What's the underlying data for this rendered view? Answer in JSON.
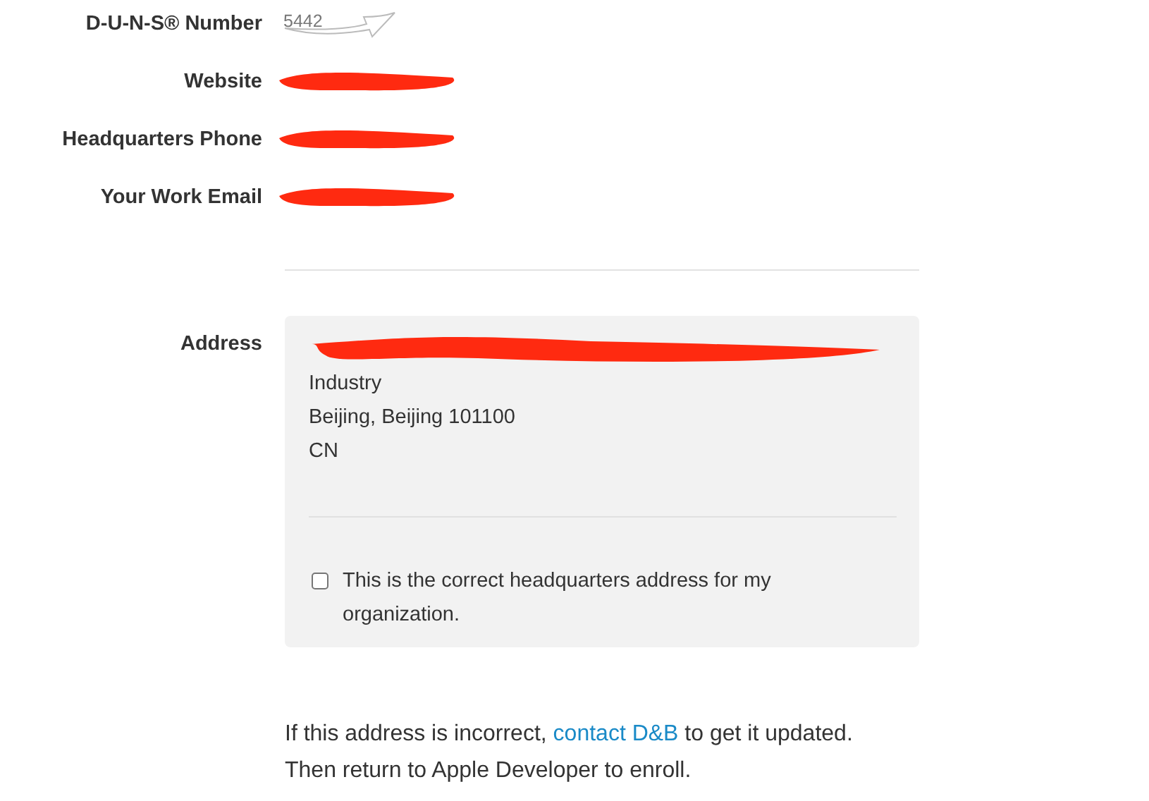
{
  "fields": [
    {
      "label": "D-U-N-S® Number",
      "value": "5442",
      "redacted": false
    },
    {
      "label": "Website",
      "redacted": true
    },
    {
      "label": "Headquarters Phone",
      "redacted": true
    },
    {
      "label": "Your Work Email",
      "redacted": true
    }
  ],
  "address": {
    "label": "Address",
    "lines": [
      {
        "kind": "redacted"
      },
      {
        "kind": "text",
        "text": "Industry"
      },
      {
        "kind": "text",
        "text": "Beijing, Beijing 101100"
      },
      {
        "kind": "text",
        "text": "CN"
      }
    ],
    "confirm": {
      "label": "This is the correct headquarters address for my organization.",
      "checked": false
    }
  },
  "note": {
    "before": "If this address is incorrect, ",
    "link": "contact D&B",
    "after": " to get it updated.",
    "line2": "Then return to Apple Developer to enroll."
  }
}
